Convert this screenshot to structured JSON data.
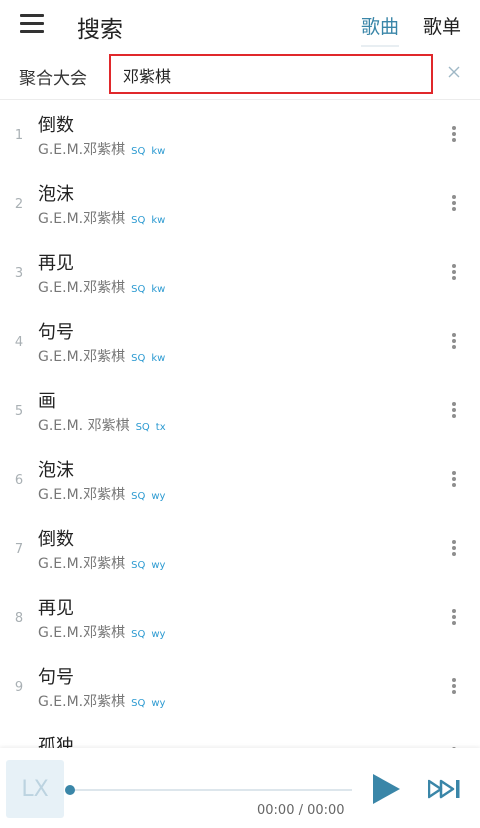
{
  "header": {
    "title": "搜索",
    "tabs": [
      {
        "label": "歌曲",
        "active": true
      },
      {
        "label": "歌单",
        "active": false
      }
    ]
  },
  "search": {
    "source_label": "聚合大会",
    "query": "邓紫棋"
  },
  "results": [
    {
      "index": "1",
      "title": "倒数",
      "artist": "G.E.M.邓紫棋",
      "quality": "SQ",
      "source": "kw"
    },
    {
      "index": "2",
      "title": "泡沫",
      "artist": "G.E.M.邓紫棋",
      "quality": "SQ",
      "source": "kw"
    },
    {
      "index": "3",
      "title": "再见",
      "artist": "G.E.M.邓紫棋",
      "quality": "SQ",
      "source": "kw"
    },
    {
      "index": "4",
      "title": "句号",
      "artist": "G.E.M.邓紫棋",
      "quality": "SQ",
      "source": "kw"
    },
    {
      "index": "5",
      "title": "画",
      "artist": "G.E.M. 邓紫棋",
      "quality": "SQ",
      "source": "tx"
    },
    {
      "index": "6",
      "title": "泡沫",
      "artist": "G.E.M.邓紫棋",
      "quality": "SQ",
      "source": "wy"
    },
    {
      "index": "7",
      "title": "倒数",
      "artist": "G.E.M.邓紫棋",
      "quality": "SQ",
      "source": "wy"
    },
    {
      "index": "8",
      "title": "再见",
      "artist": "G.E.M.邓紫棋",
      "quality": "SQ",
      "source": "wy"
    },
    {
      "index": "9",
      "title": "句号",
      "artist": "G.E.M.邓紫棋",
      "quality": "SQ",
      "source": "wy"
    },
    {
      "index": "",
      "title": "孤独",
      "artist": "",
      "quality": "",
      "source": ""
    }
  ],
  "player": {
    "cover_text": "LX",
    "time": "00:00 / 00:00",
    "progress": 0
  },
  "icons": {
    "menu": "menu-icon",
    "clear": "close-icon",
    "more": "more-vertical-icon",
    "play": "play-icon",
    "next": "skip-next-icon"
  },
  "colors": {
    "accent": "#3a86a8",
    "search_border": "#e0282b",
    "quality_tag": "#2c9ad1"
  }
}
